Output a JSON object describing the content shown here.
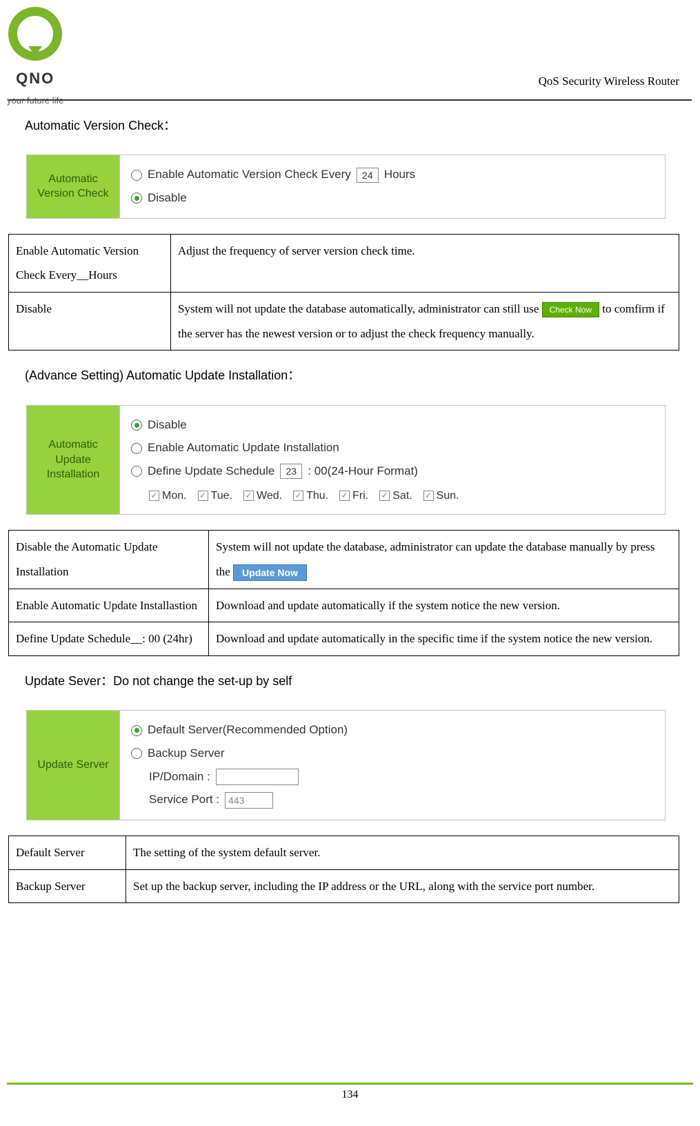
{
  "brand": {
    "name": "QNO",
    "tagline": "your future life"
  },
  "doc_title": "QoS Security Wireless Router",
  "page_number": "134",
  "section1": {
    "heading": "Automatic Version Check：",
    "panel_label": "Automatic Version Check",
    "opt_enable_pre": "Enable Automatic Version Check Every",
    "opt_enable_hours": "24",
    "opt_enable_post": "Hours",
    "opt_disable": "Disable",
    "table": {
      "r1c1": "Enable Automatic Version Check Every__Hours",
      "r1c2": "Adjust the frequency of server version check time.",
      "r2c1": "Disable",
      "r2c2a": "System will not update the database automatically, administrator can still use ",
      "r2c2_btn": "Check Now",
      "r2c2b": " to comfirm if the server has the newest version or to adjust the check frequency manually."
    }
  },
  "section2": {
    "heading": "(Advance Setting) Automatic Update Installation：",
    "panel_label": "Automatic Update Installation",
    "opt_disable": "Disable",
    "opt_enable": "Enable Automatic Update Installation",
    "opt_define_pre": "Define Update Schedule",
    "opt_define_hour": "23",
    "opt_define_post": ": 00(24-Hour Format)",
    "days": [
      "Mon.",
      "Tue.",
      "Wed.",
      "Thu.",
      "Fri.",
      "Sat.",
      "Sun."
    ],
    "table": {
      "r1c1": "Disable the Automatic Update Installation",
      "r1c2a": "System will not update the database, administrator can update the database manually by press the ",
      "r1c2_btn": "Update Now",
      "r2c1": "Enable Automatic Update Installastion",
      "r2c2": "Download and update automatically if the system notice the new version.",
      "r3c1": "Define Update Schedule__: 00 (24hr)",
      "r3c2": "Download and update automatically in the specific time if the system notice the new version."
    }
  },
  "section3": {
    "heading": "Update Sever：Do not change the set-up by self",
    "panel_label": "Update Server",
    "opt_default": "Default Server(Recommended Option)",
    "opt_backup": "Backup Server",
    "ip_label": "IP/Domain :",
    "port_label": "Service Port :",
    "port_value": "443",
    "table": {
      "r1c1": "Default Server",
      "r1c2": "The setting of the system default server.",
      "r2c1": "Backup Server",
      "r2c2": "Set up the backup server, including the IP address or the URL, along with the service port number."
    }
  }
}
